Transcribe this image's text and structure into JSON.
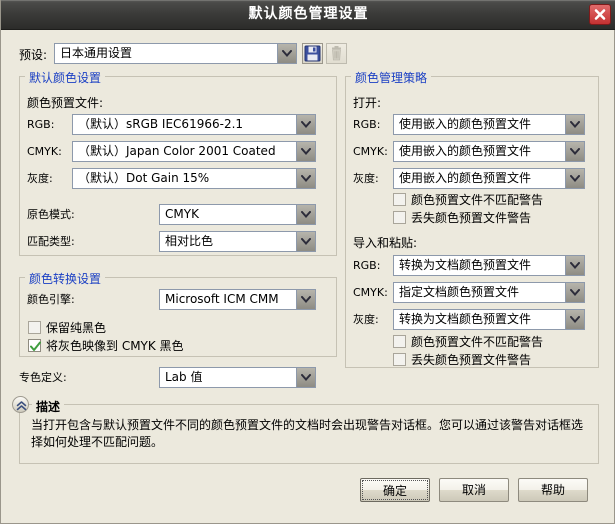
{
  "window": {
    "title": "默认颜色管理设置",
    "close_icon": "close-icon"
  },
  "preset": {
    "label": "预设:",
    "value": "日本通用设置",
    "save_icon": "save-floppy-icon",
    "delete_icon": "trash-icon"
  },
  "default_color_settings": {
    "title": "默认颜色设置",
    "profiles_label": "颜色预置文件:",
    "rows": [
      {
        "label": "RGB:",
        "value": "（默认）sRGB IEC61966-2.1"
      },
      {
        "label": "CMYK:",
        "value": "（默认）Japan Color 2001 Coated"
      },
      {
        "label": "灰度:",
        "value": "（默认）Dot Gain 15%"
      }
    ],
    "primary_mode": {
      "label": "原色模式:",
      "value": "CMYK"
    },
    "rendering_intent": {
      "label": "匹配类型:",
      "value": "相对比色"
    }
  },
  "color_conversion": {
    "title": "颜色转换设置",
    "engine": {
      "label": "颜色引擎:",
      "value": "Microsoft ICM CMM"
    },
    "checkboxes": [
      {
        "label": "保留纯黑色",
        "checked": false
      },
      {
        "label": "将灰色映像到 CMYK 黑色",
        "checked": true
      }
    ]
  },
  "spot_color": {
    "label": "专色定义:",
    "value": "Lab 值"
  },
  "policies": {
    "title": "颜色管理策略",
    "open_label": "打开:",
    "open_rows": [
      {
        "label": "RGB:",
        "value": "使用嵌入的颜色预置文件"
      },
      {
        "label": "CMYK:",
        "value": "使用嵌入的颜色预置文件"
      },
      {
        "label": "灰度:",
        "value": "使用嵌入的颜色预置文件"
      }
    ],
    "open_checkboxes": [
      {
        "label": "颜色预置文件不匹配警告",
        "checked": false
      },
      {
        "label": "丢失颜色预置文件警告",
        "checked": false
      }
    ],
    "paste_label": "导入和粘贴:",
    "paste_rows": [
      {
        "label": "RGB:",
        "value": "转换为文档颜色预置文件"
      },
      {
        "label": "CMYK:",
        "value": "指定文档颜色预置文件"
      },
      {
        "label": "灰度:",
        "value": "转换为文档颜色预置文件"
      }
    ],
    "paste_checkboxes": [
      {
        "label": "颜色预置文件不匹配警告",
        "checked": false
      },
      {
        "label": "丢失颜色预置文件警告",
        "checked": false
      }
    ]
  },
  "description": {
    "collapse_icon": "chevron-up-double-icon",
    "title": "描述",
    "text": "当打开包含与默认预置文件不同的颜色预置文件的文档时会出现警告对话框。您可以通过该警告对话框选择如何处理不匹配问题。"
  },
  "buttons": {
    "ok": "确定",
    "cancel": "取消",
    "help": "帮助"
  },
  "colors": {
    "dialog_bg": "#ece9dd",
    "title_bar": "#3c3c3a",
    "group_label": "#1a3fc4",
    "close_red": "#c53131",
    "check_green": "#3f9e3f",
    "save_blue": "#3b4f9e"
  }
}
